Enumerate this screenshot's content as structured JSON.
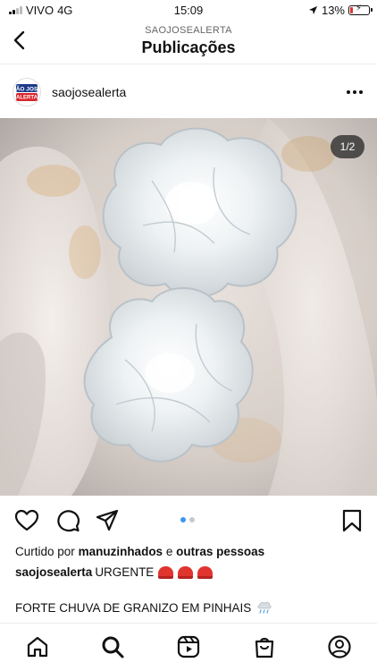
{
  "status_bar": {
    "carrier": "VIVO",
    "network": "4G",
    "time": "15:09",
    "battery_percent": "13%",
    "battery_level": 0.13
  },
  "header": {
    "account": "SAOJOSEALERTA",
    "title": "Publicações"
  },
  "post": {
    "avatar_text": "SÃO JOSÉ ALERTA",
    "username": "saojosealerta",
    "image_counter": "1/2",
    "carousel": {
      "total": 2,
      "current": 1
    },
    "likes_prefix": "Curtido por",
    "likes_user": "manuzinhados",
    "likes_joiner": "e",
    "likes_others": "outras pessoas",
    "caption_user": "saojosealerta",
    "caption_text": "URGENTE",
    "caption_line2": "FORTE CHUVA DE GRANIZO EM PINHAIS"
  },
  "colors": {
    "accent_blue": "#3897f0",
    "siren_red": "#e0342f"
  }
}
